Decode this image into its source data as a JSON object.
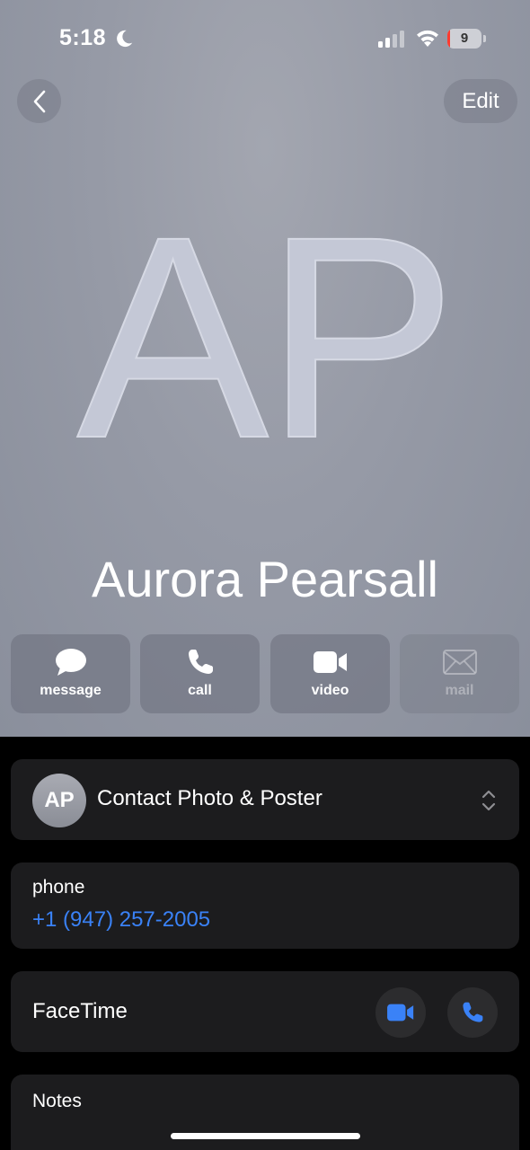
{
  "status_bar": {
    "time": "5:18",
    "battery_level": "9",
    "battery_fraction": 0.09,
    "battery_color": "#ff3b30"
  },
  "nav": {
    "edit_label": "Edit"
  },
  "contact": {
    "monogram": "AP",
    "name": "Aurora Pearsall"
  },
  "actions": [
    {
      "label": "message",
      "icon": "message-bubble-icon",
      "enabled": true
    },
    {
      "label": "call",
      "icon": "phone-icon",
      "enabled": true
    },
    {
      "label": "video",
      "icon": "video-camera-icon",
      "enabled": true
    },
    {
      "label": "mail",
      "icon": "envelope-icon",
      "enabled": false
    }
  ],
  "poster_card": {
    "avatar_initials": "AP",
    "title": "Contact Photo & Poster"
  },
  "phone_card": {
    "label": "phone",
    "number": "+1 (947) 257-2005"
  },
  "facetime_card": {
    "label": "FaceTime"
  },
  "notes_card": {
    "label": "Notes"
  },
  "colors": {
    "link_blue": "#3a82f7",
    "card_bg": "#1c1c1e"
  }
}
